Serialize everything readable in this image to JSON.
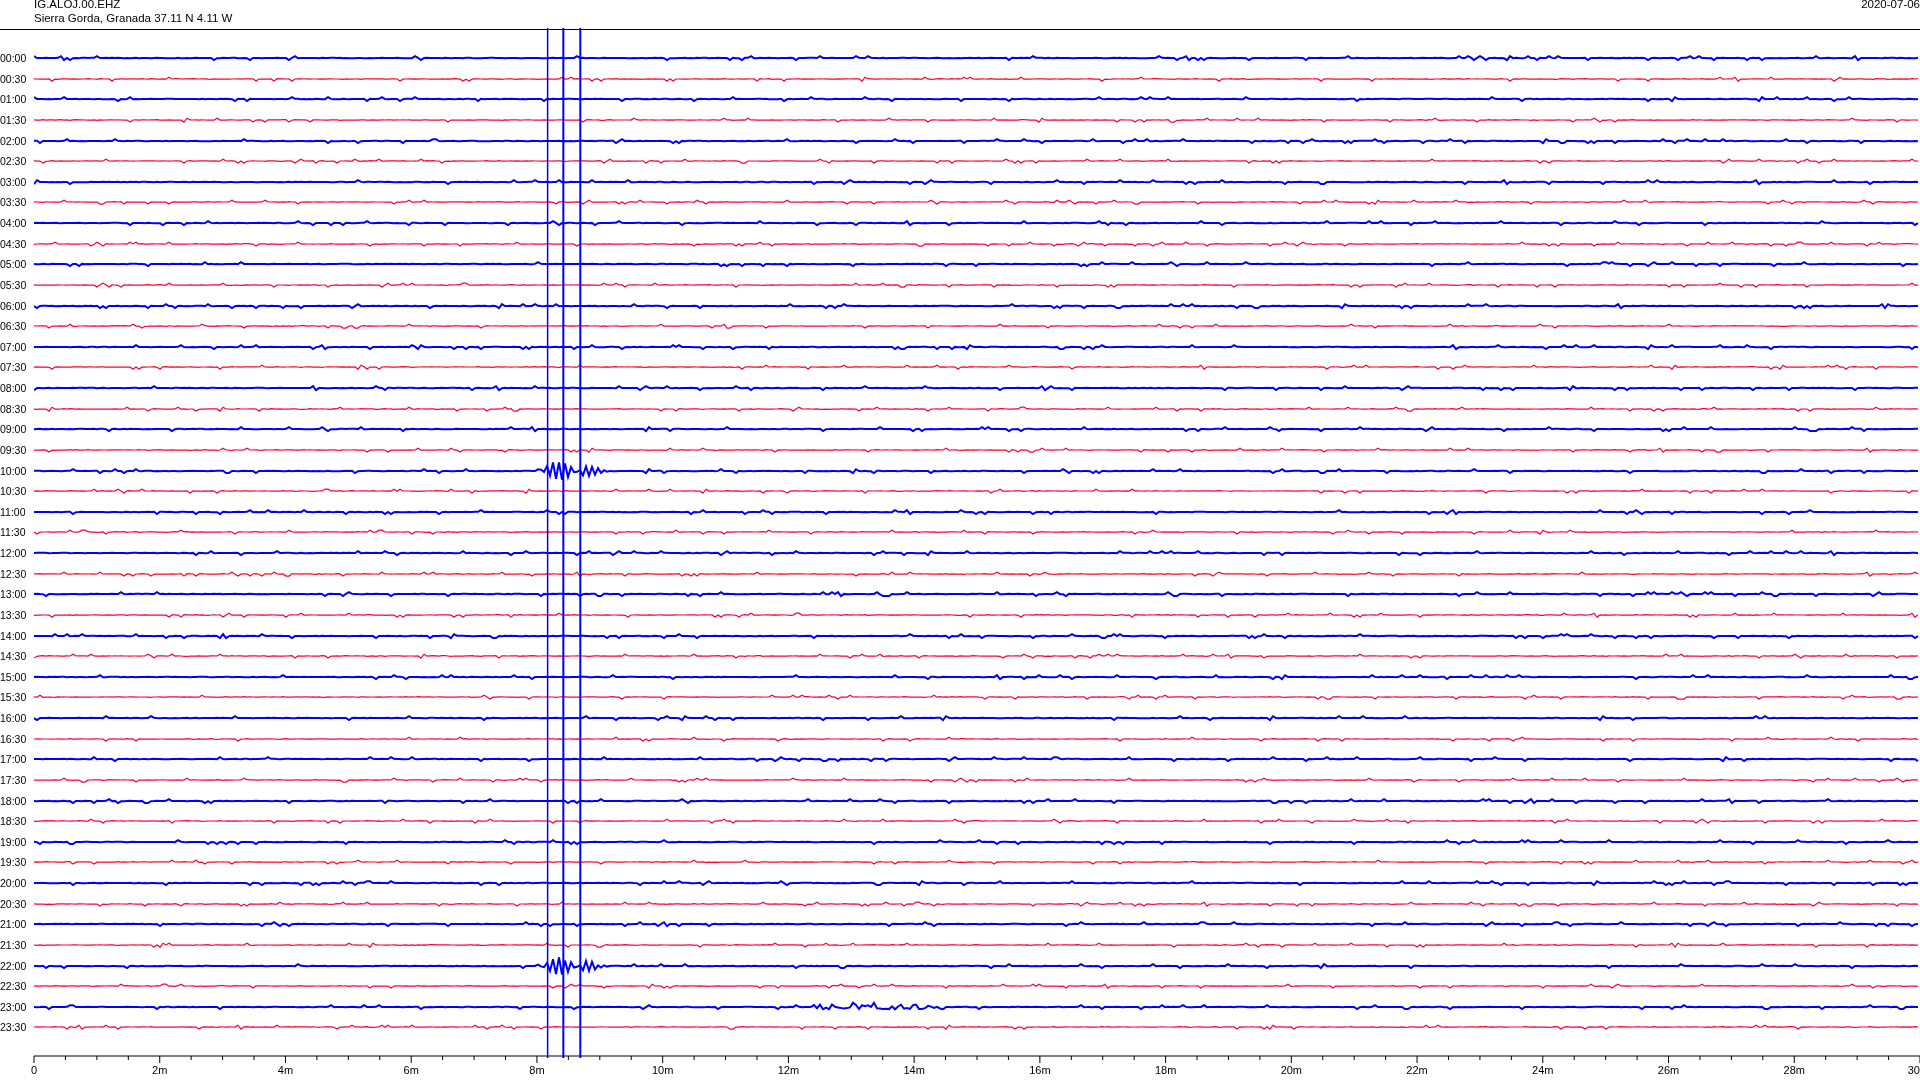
{
  "header": {
    "station": "IG.ALOJ.00.EHZ",
    "location": "Sierra Gorda, Granada  37.11 N 4.11 W",
    "date": "2020-07-06"
  },
  "rows": [
    {
      "label": "00:00",
      "color": "#0000ff"
    },
    {
      "label": "00:30",
      "color": "#ff0033"
    },
    {
      "label": "01:00",
      "color": "#0000ff"
    },
    {
      "label": "01:30",
      "color": "#ff0033"
    },
    {
      "label": "02:00",
      "color": "#0000ff"
    },
    {
      "label": "02:30",
      "color": "#ff0033"
    },
    {
      "label": "03:00",
      "color": "#0000ff"
    },
    {
      "label": "03:30",
      "color": "#ff0033"
    },
    {
      "label": "04:00",
      "color": "#0000ff"
    },
    {
      "label": "04:30",
      "color": "#ff0033"
    },
    {
      "label": "05:00",
      "color": "#0000ff"
    },
    {
      "label": "05:30",
      "color": "#ff0033"
    },
    {
      "label": "06:00",
      "color": "#0000ff"
    },
    {
      "label": "06:30",
      "color": "#ff0033"
    },
    {
      "label": "07:00",
      "color": "#0000ff"
    },
    {
      "label": "07:30",
      "color": "#ff0033"
    },
    {
      "label": "08:00",
      "color": "#0000ff"
    },
    {
      "label": "08:30",
      "color": "#ff0033"
    },
    {
      "label": "09:00",
      "color": "#0000ff"
    },
    {
      "label": "09:30",
      "color": "#ff0033"
    },
    {
      "label": "10:00",
      "color": "#0000ff"
    },
    {
      "label": "10:30",
      "color": "#ff0033"
    },
    {
      "label": "11:00",
      "color": "#0000ff"
    },
    {
      "label": "11:30",
      "color": "#ff0033"
    },
    {
      "label": "12:00",
      "color": "#0000ff"
    },
    {
      "label": "12:30",
      "color": "#ff0033"
    },
    {
      "label": "13:00",
      "color": "#0000ff"
    },
    {
      "label": "13:30",
      "color": "#ff0033"
    },
    {
      "label": "14:00",
      "color": "#0000ff"
    },
    {
      "label": "14:30",
      "color": "#ff0033"
    },
    {
      "label": "15:00",
      "color": "#0000ff"
    },
    {
      "label": "15:30",
      "color": "#ff0033"
    },
    {
      "label": "16:00",
      "color": "#0000ff"
    },
    {
      "label": "16:30",
      "color": "#ff0033"
    },
    {
      "label": "17:00",
      "color": "#0000ff"
    },
    {
      "label": "17:30",
      "color": "#ff0033"
    },
    {
      "label": "18:00",
      "color": "#0000ff"
    },
    {
      "label": "18:30",
      "color": "#ff0033"
    },
    {
      "label": "19:00",
      "color": "#0000ff"
    },
    {
      "label": "19:30",
      "color": "#ff0033"
    },
    {
      "label": "20:00",
      "color": "#0000ff"
    },
    {
      "label": "20:30",
      "color": "#ff0033"
    },
    {
      "label": "21:00",
      "color": "#0000ff"
    },
    {
      "label": "21:30",
      "color": "#ff0033"
    },
    {
      "label": "22:00",
      "color": "#0000ff"
    },
    {
      "label": "22:30",
      "color": "#ff0033"
    },
    {
      "label": "23:00",
      "color": "#0000ff"
    },
    {
      "label": "23:30",
      "color": "#ff0033"
    }
  ],
  "x_axis_labels": [
    "0",
    "2m",
    "4m",
    "6m",
    "8m",
    "10m",
    "12m",
    "14m",
    "16m",
    "18m",
    "20m",
    "22m",
    "24m",
    "26m",
    "28m",
    "30"
  ]
}
